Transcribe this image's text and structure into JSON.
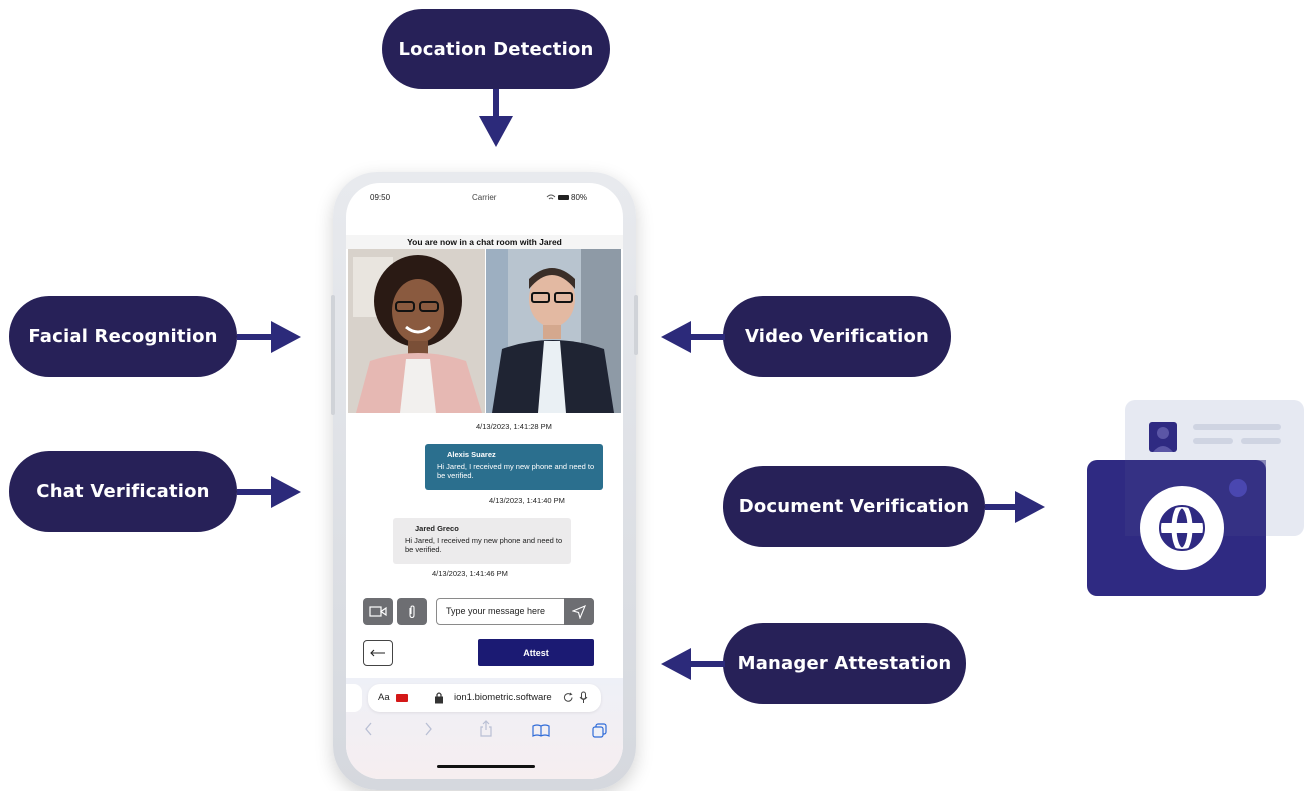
{
  "labels": {
    "location": "Location Detection",
    "facial": "Facial Recognition",
    "chat": "Chat Verification",
    "video": "Video Verification",
    "document": "Document Verification",
    "manager": "Manager Attestation"
  },
  "phone": {
    "status": {
      "time": "09:50",
      "carrier": "Carrier",
      "battery": "80%"
    },
    "chat_header": "You are now in a chat room with Jared",
    "timestamps": [
      "4/13/2023, 1:41:28 PM",
      "4/13/2023, 1:41:40 PM",
      "4/13/2023, 1:41:46 PM"
    ],
    "messages": [
      {
        "author": "Alexis Suarez",
        "text": "Hi Jared, I received my new phone and need to be verified."
      },
      {
        "author": "Jared Greco",
        "text": "Hi Jared, I received my new phone and need to be verified."
      }
    ],
    "input_placeholder": "Type your message here",
    "attest_label": "Attest",
    "browser": {
      "text_size": "Aa",
      "url": "ion1.biometric.software"
    }
  },
  "colors": {
    "pill": "#272158",
    "arrow": "#2c2a7a",
    "bubble_out": "#2b6f8e",
    "bubble_in": "#ecebec",
    "attest": "#1b1a73",
    "doc_front": "#2f2a82",
    "doc_back": "#e6e9f2"
  },
  "icons": [
    "video-camera-icon",
    "paperclip-icon",
    "send-icon",
    "back-arrow-icon",
    "lock-icon",
    "refresh-icon",
    "microphone-icon",
    "share-icon",
    "book-icon",
    "tabs-icon",
    "globe-icon",
    "id-card-icon"
  ]
}
